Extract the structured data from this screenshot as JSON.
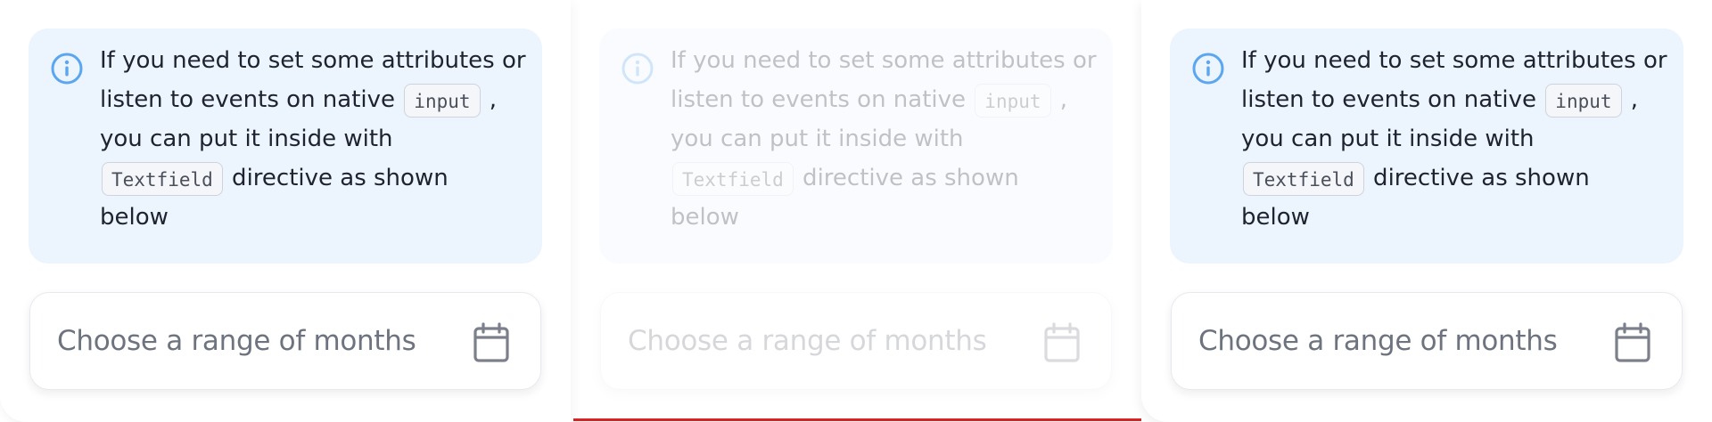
{
  "callout": {
    "line1": "If you need to set some attributes or",
    "line2_prefix": "listen to events on native ",
    "code_input": "input",
    "line2_suffix": " ,",
    "line3": "you can put it inside with",
    "code_textfield": "Textfield",
    "line4_suffix": " directive as shown",
    "line5": "below",
    "icon": "info-icon"
  },
  "field": {
    "placeholder": "Choose a range of months",
    "icon": "calendar-icon"
  },
  "colors": {
    "callout_bg": "#ecf4fe",
    "info_icon": "#5aa6f0",
    "text": "#1f2330",
    "placeholder": "#6e7380",
    "calendar_icon": "#7c808c",
    "active_underline": "#e02020"
  }
}
